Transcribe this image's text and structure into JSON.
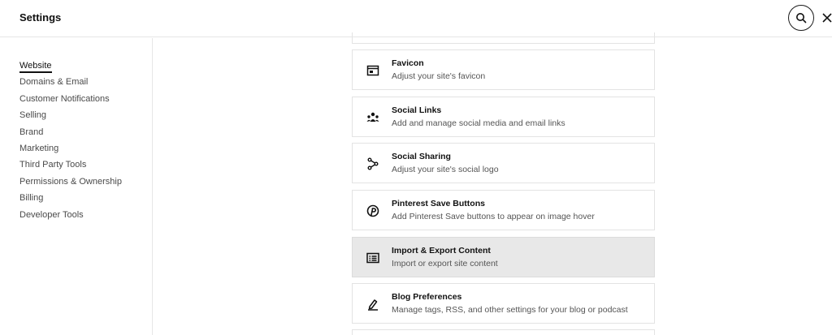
{
  "header": {
    "title": "Settings",
    "search_icon": "search-icon",
    "close_icon": "close-icon"
  },
  "sidebar": {
    "items": [
      {
        "label": "Website",
        "active": true
      },
      {
        "label": "Domains & Email"
      },
      {
        "label": "Customer Notifications"
      },
      {
        "label": "Selling"
      },
      {
        "label": "Brand"
      },
      {
        "label": "Marketing"
      },
      {
        "label": "Third Party Tools"
      },
      {
        "label": "Permissions & Ownership"
      },
      {
        "label": "Billing"
      },
      {
        "label": "Developer Tools"
      }
    ]
  },
  "cards": [
    {
      "title": "Favicon",
      "subtitle": "Adjust your site's favicon",
      "icon": "favicon-icon"
    },
    {
      "title": "Social Links",
      "subtitle": "Add and manage social media and email links",
      "icon": "people-icon"
    },
    {
      "title": "Social Sharing",
      "subtitle": "Adjust your site's social logo",
      "icon": "share-icon"
    },
    {
      "title": "Pinterest Save Buttons",
      "subtitle": "Add Pinterest Save buttons to appear on image hover",
      "icon": "pinterest-icon"
    },
    {
      "title": "Import & Export Content",
      "subtitle": "Import or export site content",
      "icon": "list-icon",
      "highlighted": true
    },
    {
      "title": "Blog Preferences",
      "subtitle": "Manage tags, RSS, and other settings for your blog or podcast",
      "icon": "blog-pen-icon"
    }
  ]
}
